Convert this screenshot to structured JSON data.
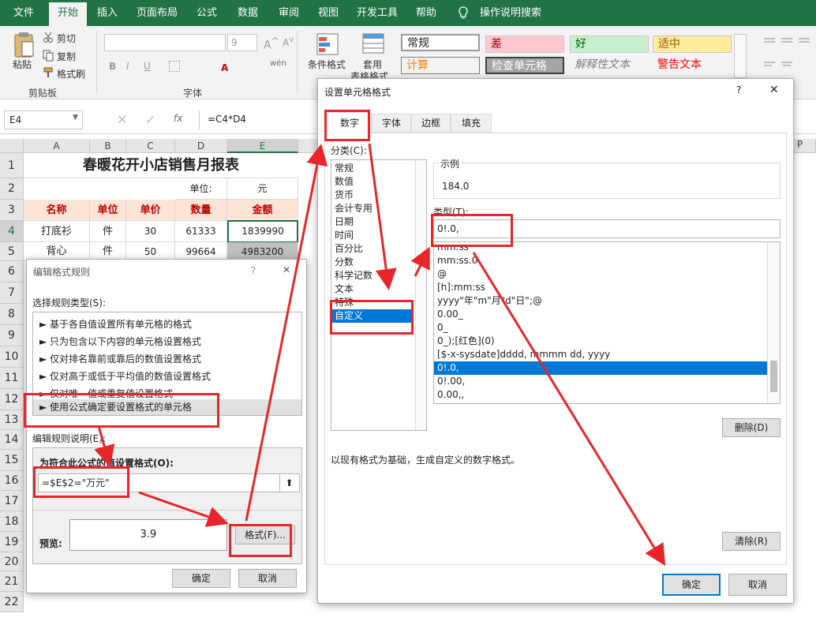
{
  "menu": {
    "items": [
      "文件",
      "开始",
      "插入",
      "页面布局",
      "公式",
      "数据",
      "审阅",
      "视图",
      "开发工具",
      "帮助"
    ],
    "tell_me": "操作说明搜索"
  },
  "ribbon": {
    "paste": "粘贴",
    "cut": "剪切",
    "copy": "复制",
    "format_painter": "格式刷",
    "clipboard_group": "剪贴板",
    "font_group": "字体",
    "font_size": "9",
    "bold": "B",
    "italic": "I",
    "underline": "U",
    "wen": "wén",
    "cond_format": "条件格式",
    "table_format_1": "套用",
    "table_format_2": "表格格式",
    "styles": {
      "normal": "常规",
      "bad": "差",
      "good": "好",
      "neutral": "适中",
      "calc": "计算",
      "check": "检查单元格",
      "explain": "解释性文本",
      "warn": "警告文本"
    }
  },
  "formula_bar": {
    "name_box": "E4",
    "fx": "fx",
    "formula": "=C4*D4"
  },
  "columns": [
    "A",
    "B",
    "C",
    "D",
    "E"
  ],
  "col_p": "P",
  "rows": [
    "1",
    "2",
    "3",
    "4",
    "5",
    "6",
    "7",
    "8",
    "9",
    "10",
    "11",
    "12",
    "13",
    "14",
    "15",
    "16",
    "17",
    "18",
    "19",
    "20",
    "21",
    "22"
  ],
  "sheet": {
    "title": "春暖花开小店销售月报表",
    "unit_label": "单位:",
    "unit": "元",
    "headers": [
      "名称",
      "单位",
      "单价",
      "数量",
      "金额"
    ],
    "r4": [
      "打底衫",
      "件",
      "30",
      "61333",
      "1839990"
    ],
    "r5": [
      "背心",
      "件",
      "50",
      "99664",
      "4983200"
    ]
  },
  "rule_dialog": {
    "title": "编辑格式规则",
    "help": "?",
    "close": "✕",
    "select_label": "选择规则类型(S):",
    "rules": [
      "► 基于各自值设置所有单元格的格式",
      "► 只为包含以下内容的单元格设置格式",
      "► 仅对排名靠前或靠后的数值设置格式",
      "► 仅对高于或低于平均值的数值设置格式",
      "► 仅对唯一值或重复值设置格式",
      "► 使用公式确定要设置格式的单元格"
    ],
    "edit_label": "编辑规则说明(E):",
    "formula_label": "为符合此公式的值设置格式(O):",
    "formula": "=$E$2=\"万元\"",
    "preview_label": "预览:",
    "preview": "3.9",
    "format_btn": "格式(F)...",
    "ok": "确定",
    "cancel": "取消"
  },
  "cell_dialog": {
    "title": "设置单元格格式",
    "help": "?",
    "close": "✕",
    "tabs": [
      "数字",
      "字体",
      "边框",
      "填充"
    ],
    "category_label": "分类(C):",
    "categories": [
      "常规",
      "数值",
      "货币",
      "会计专用",
      "日期",
      "时间",
      "百分比",
      "分数",
      "科学记数",
      "文本",
      "特殊",
      "自定义"
    ],
    "sample_label": "示例",
    "sample": "184.0",
    "type_label": "类型(T):",
    "type_value": "0!.0,",
    "formats": [
      "mm:ss",
      "mm:ss.0",
      "@",
      "[h]:mm:ss",
      "yyyy\"年\"m\"月\"d\"日\";@",
      "0.00_",
      "0_",
      "0_);[红色](0)",
      "[$-x-sysdate]dddd, mmmm dd, yyyy",
      "0!.0,",
      "0!.00,",
      "0.00,,"
    ],
    "delete_btn": "删除(D)",
    "desc": "以现有格式为基础，生成自定义的数字格式。",
    "clear_btn": "清除(R)",
    "ok": "确定",
    "cancel": "取消"
  }
}
